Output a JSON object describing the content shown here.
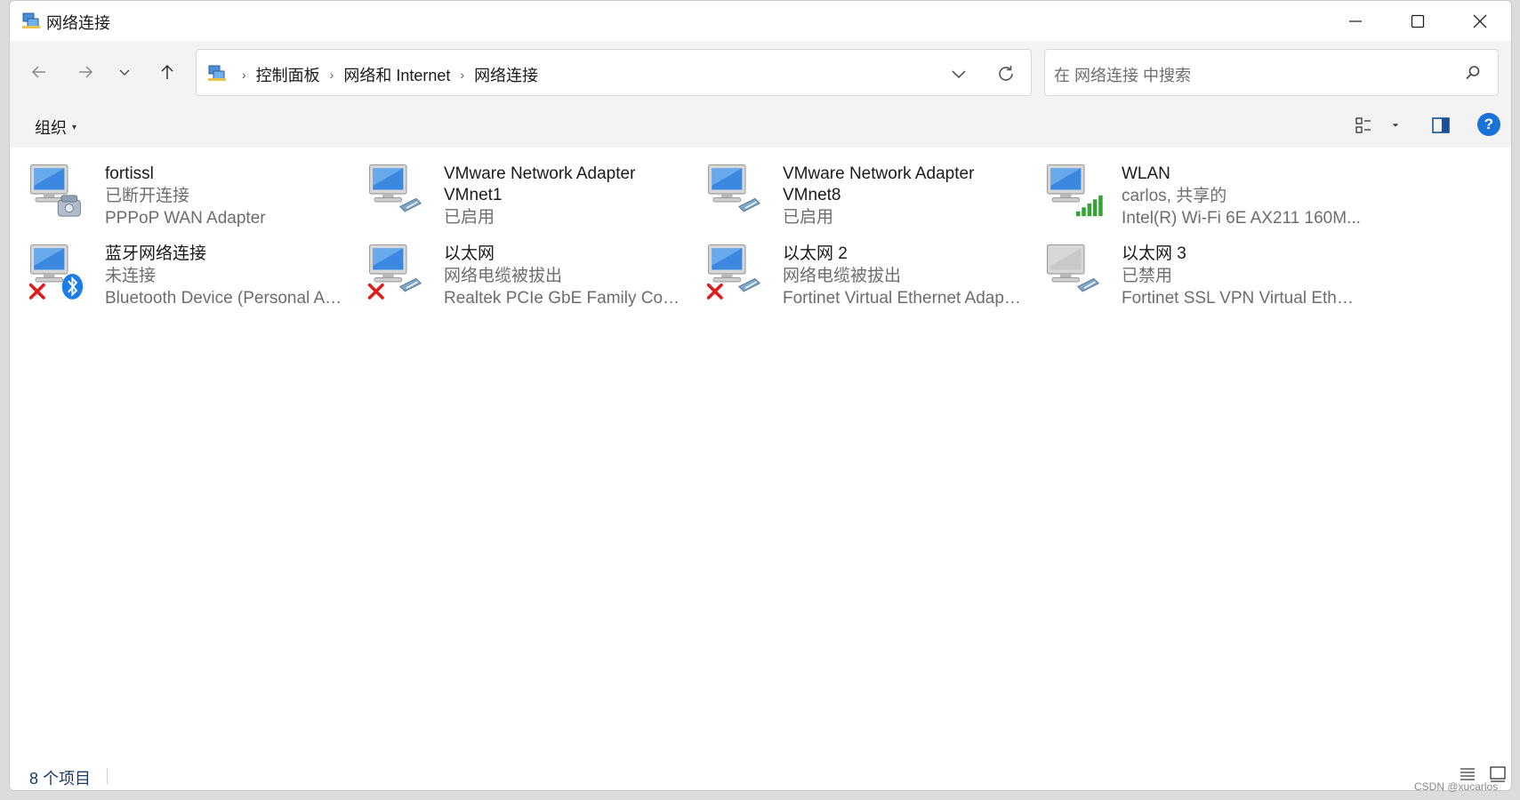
{
  "window": {
    "title": "网络连接"
  },
  "title_buttons": {
    "minimize": "minimize-icon",
    "maximize": "maximize-icon",
    "close": "close-icon"
  },
  "nav": {
    "back": "arrow-left-icon",
    "forward": "arrow-right-icon",
    "recent": "chevron-down-icon",
    "up": "arrow-up-icon"
  },
  "address": {
    "icon": "network-connections-icon",
    "crumbs": [
      "控制面板",
      "网络和 Internet",
      "网络连接"
    ],
    "separator": "›"
  },
  "search": {
    "placeholder": "在 网络连接 中搜索",
    "icon": "search-icon"
  },
  "toolbar": {
    "organize_label": "组织",
    "organize_caret": "▾",
    "help_label": "?"
  },
  "connections": [
    {
      "name": "fortissl",
      "status": "已断开连接",
      "device": "PPPoP WAN Adapter",
      "icon": "dialup-modem-icon",
      "overlay": "none"
    },
    {
      "name": "VMware Network Adapter VMnet1",
      "status": "已启用",
      "device": "",
      "icon": "network-adapter-icon",
      "overlay": "none"
    },
    {
      "name": "VMware Network Adapter VMnet8",
      "status": "已启用",
      "device": "",
      "icon": "network-adapter-icon",
      "overlay": "none"
    },
    {
      "name": "WLAN",
      "status": "carlos, 共享的",
      "device": "Intel(R) Wi-Fi 6E AX211 160M...",
      "icon": "wifi-signal-icon",
      "overlay": "none"
    },
    {
      "name": "蓝牙网络连接",
      "status": "未连接",
      "device": "Bluetooth Device (Personal Are...",
      "icon": "bluetooth-icon",
      "overlay": "red-x-icon"
    },
    {
      "name": "以太网",
      "status": "网络电缆被拔出",
      "device": "Realtek PCIe GbE Family Contr...",
      "icon": "network-adapter-icon",
      "overlay": "red-x-icon"
    },
    {
      "name": "以太网 2",
      "status": "网络电缆被拔出",
      "device": "Fortinet Virtual Ethernet Adapt...",
      "icon": "network-adapter-icon",
      "overlay": "red-x-icon"
    },
    {
      "name": "以太网 3",
      "status": "已禁用",
      "device": "Fortinet SSL VPN Virtual Ethern...",
      "icon": "network-adapter-disabled-icon",
      "overlay": "none"
    }
  ],
  "status": {
    "count": "8 个项目"
  },
  "watermark": "CSDN @xucarlos"
}
